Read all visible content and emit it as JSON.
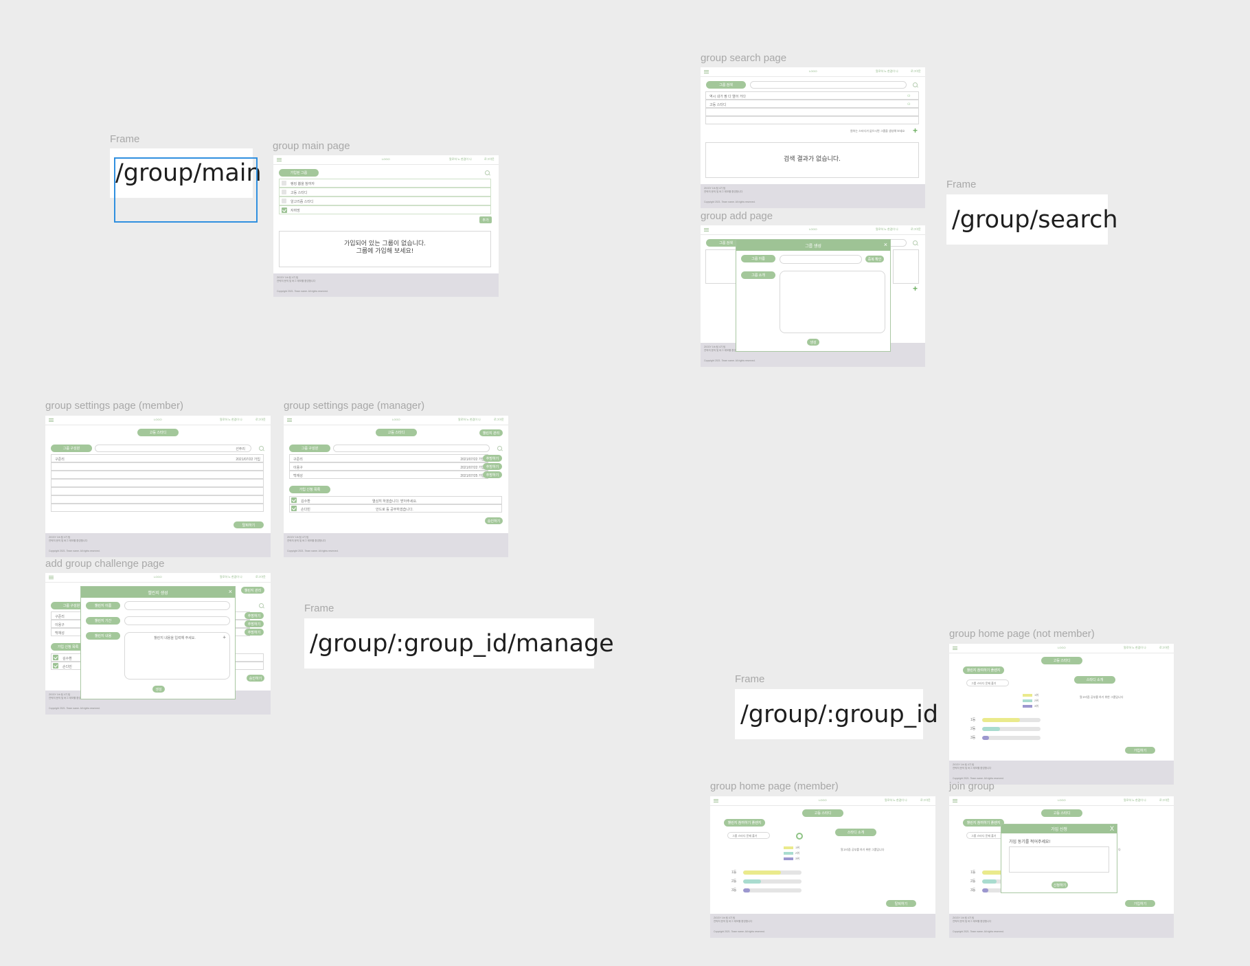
{
  "labels": {
    "frame": "Frame",
    "group_main_page": "group main page",
    "group_search_page": "group search page",
    "group_add_page": "group add page",
    "group_settings_member": "group settings page (member)",
    "group_settings_manager": "group settings page (manager)",
    "add_group_challenge": "add group challenge page",
    "group_home_not_member": "group home page (not member)",
    "group_home_member": "group home page (member)",
    "join_group": "join group"
  },
  "routes": {
    "main": "/group/main",
    "search": "/group/search",
    "manage": "/group/:group_id/manage",
    "group_id": "/group/:group_id"
  },
  "main_page": {
    "pill": "가입된 그룹",
    "items": [
      "랭킹 뽑을 참여자",
      "고등 스타디",
      "알고리즘 스타디",
      "자취방"
    ],
    "button": "추가",
    "empty_line1": "가입되어 있는 그룹이 없습니다.",
    "empty_line2": "그룹에 가입해 보세요!"
  },
  "search_page": {
    "pill": "그룹 검색",
    "rows": [
      "역시 내가 짱 다 열어 거다",
      "고등 스타디"
    ],
    "hint": "원하는 스타디가 없으시면 그룹을 생성해 보세요",
    "empty": "검색 결과가 없습니다."
  },
  "add_page": {
    "modal_title": "그룹 생성",
    "close": "×",
    "name_pill": "그룹 이름",
    "desc_pill": "그룹 소개",
    "dup_button": "중복 확인",
    "submit": "생성"
  },
  "settings_member": {
    "top_pill": "고등 스타디",
    "members_pill": "그룹 구성원",
    "search_value": "선주리",
    "row_name": "구준리",
    "row_date": "2021/07/22 가입",
    "leave": "탈퇴하기"
  },
  "settings_manager": {
    "top_pill": "고등 스타디",
    "action": "챌린지 관리",
    "members_pill": "그룹 구성원",
    "members": [
      {
        "name": "구준리",
        "date": "2021/07/22 가입",
        "btn": "추방하기"
      },
      {
        "name": "이용구",
        "date": "2021/07/22 가입",
        "btn": "추방하기"
      },
      {
        "name": "백재성",
        "date": "2021/07/25 가입",
        "btn": "추방하기"
      }
    ],
    "requests_pill": "가입 신청 목록",
    "requests": [
      {
        "name": "김수환",
        "msg": "열심히 하겠습니다. 받아주세요."
      },
      {
        "name": "손다빈",
        "msg": "안드로 등 공부하겠습니다."
      }
    ],
    "approve": "승인하기"
  },
  "challenge_page": {
    "modal_title": "챌린지 생성",
    "close": "×",
    "fields": [
      "챌린지 이름",
      "챌린지 기간",
      "챌린지 내용"
    ],
    "content_hint": "챌린지 내용을 입력해 주세요.",
    "submit": "생성"
  },
  "group_home": {
    "title_pill": "고등 스타디",
    "left_pill": "챌린지 참여하기 플렌지",
    "challenge_item": "그룹 스타디 문제 풀기",
    "intro_pill": "스타디 소개",
    "intro_text": "알고리즘 공부를 하기 위한 그룹입니다",
    "legend": [
      "1위",
      "2위",
      "3위"
    ],
    "ranks": [
      {
        "label": "1등",
        "value": 0.65,
        "color": "#eaea8c"
      },
      {
        "label": "2등",
        "value": 0.3,
        "color": "#a9dccf"
      },
      {
        "label": "3등",
        "value": 0.12,
        "color": "#9c97cf"
      }
    ],
    "join_button": "가입하기",
    "leave_button": "탈퇴하기",
    "join_modal_title": "가입 신청",
    "join_modal_close": "X",
    "join_modal_hint": "가입 동기를 적어주세요!",
    "join_modal_submit": "신청하기"
  },
  "common": {
    "logo": "LOGO",
    "user_link": "알로하 노 한겹이 나",
    "logout": "로그아웃",
    "footer_line1": "ZIGGY 1th 팀 4기 팀",
    "footer_line2": "연락처 문의 및 버그 제보를 환영합니다",
    "copyright": "Copyright 2021. Team name. All rights reserved."
  },
  "colors": {
    "accent": "#a3c79a",
    "footer": "#dfdde3",
    "background": "#ececec",
    "selection": "#2f8fdf"
  }
}
